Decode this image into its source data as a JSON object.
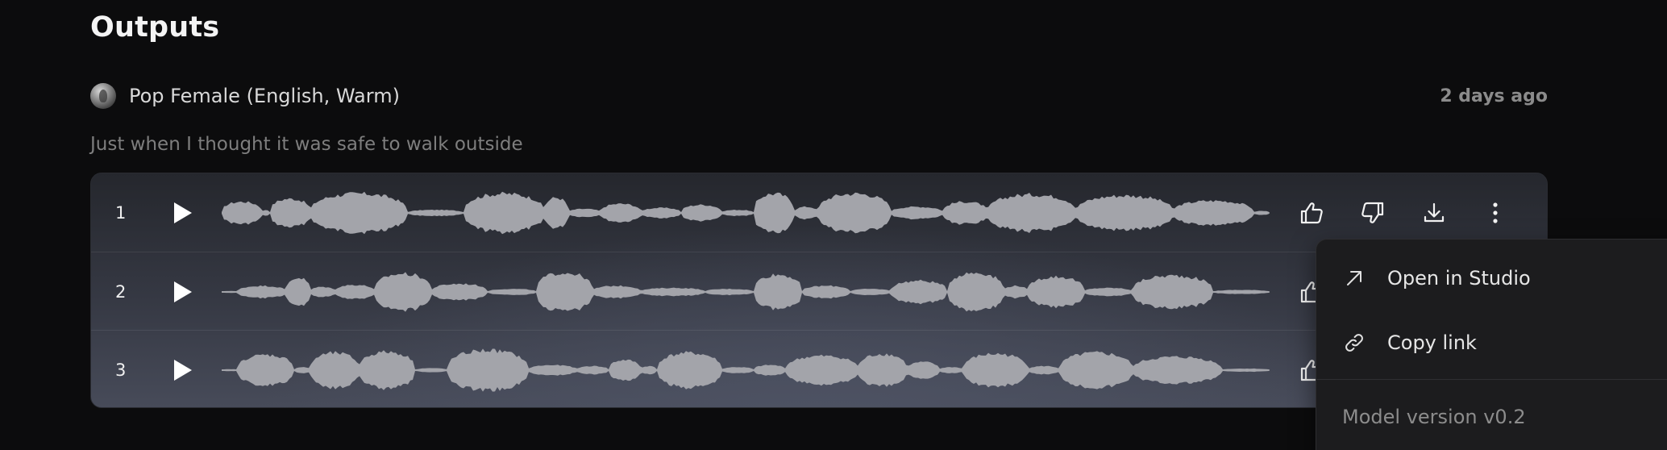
{
  "header": {
    "title": "Outputs"
  },
  "generation": {
    "voice_name": "Pop Female (English, Warm)",
    "timestamp": "2 days ago",
    "prompt": "Just when I thought it was safe to walk outside"
  },
  "outputs": [
    {
      "index": "1"
    },
    {
      "index": "2"
    },
    {
      "index": "3"
    }
  ],
  "row_actions": [
    "thumbs-up-icon",
    "thumbs-down-icon",
    "download-icon",
    "more-vertical-icon"
  ],
  "menu": {
    "items": [
      {
        "label": "Open in Studio",
        "icon": "arrow-up-right-icon"
      },
      {
        "label": "Copy link",
        "icon": "link-icon"
      }
    ],
    "footer": "Model version v0.2"
  },
  "colors": {
    "background": "#0c0c0d",
    "waveform": "#a3a4aa",
    "panel_top": "#25272d",
    "panel_bottom": "#474b59",
    "menu_bg": "#1c1c1e"
  }
}
